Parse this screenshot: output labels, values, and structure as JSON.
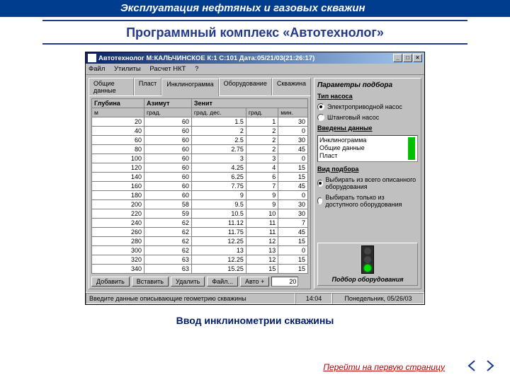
{
  "page": {
    "header": "Эксплуатация нефтяных и газовых скважин",
    "subtitle": "Программный комплекс «Автотехнолог»",
    "caption": "Ввод инклинометрии скважины",
    "first_page_link": "Перейти на первую страницу"
  },
  "app": {
    "title": "Автотехнолог М:КАЛЬЧИНСКОЕ  К:1  С:101  Дата:05/21/03(21:26:17)",
    "menu": [
      "Файл",
      "Утилиты",
      "Расчет НКТ",
      "?"
    ],
    "tabs": [
      "Общие данные",
      "Пласт",
      "Инклинограмма",
      "Оборудование",
      "Скважина"
    ],
    "active_tab": 2,
    "table": {
      "headers": [
        "Глубина",
        "Азимут",
        "Зенит",
        ""
      ],
      "subheaders": [
        "м",
        "град.",
        "град. дес.",
        "град.",
        "мин."
      ],
      "rows": [
        [
          20,
          60,
          1.5,
          1,
          30
        ],
        [
          40,
          60,
          2,
          2,
          0
        ],
        [
          60,
          60,
          2.5,
          2,
          30
        ],
        [
          80,
          60,
          2.75,
          2,
          45
        ],
        [
          100,
          60,
          3,
          3,
          0
        ],
        [
          120,
          60,
          4.25,
          4,
          15
        ],
        [
          140,
          60,
          6.25,
          6,
          15
        ],
        [
          160,
          60,
          7.75,
          7,
          45
        ],
        [
          180,
          60,
          9,
          9,
          0
        ],
        [
          200,
          58,
          9.5,
          9,
          30
        ],
        [
          220,
          59,
          10.5,
          10,
          30
        ],
        [
          240,
          62,
          11.12,
          11,
          7
        ],
        [
          260,
          62,
          11.75,
          11,
          45
        ],
        [
          280,
          62,
          12.25,
          12,
          15
        ],
        [
          300,
          62,
          13,
          13,
          0
        ],
        [
          320,
          63,
          12.25,
          12,
          15
        ],
        [
          340,
          63,
          15.25,
          15,
          15
        ]
      ]
    },
    "buttons": {
      "add": "Добавить",
      "insert": "Вставить",
      "delete": "Удалить",
      "file": "Файл...",
      "auto": "Авто +"
    },
    "step_value": "20",
    "params": {
      "title": "Параметры подбора",
      "pump_type_label": "Тип насоса",
      "pump_options": [
        "Электроприводной насос",
        "Штанговый насос"
      ],
      "pump_selected": 0,
      "data_entered_label": "Введены данные",
      "data_entered": [
        "Инклинограмма",
        "Общие данные",
        "Пласт"
      ],
      "mode_label": "Вид подбора",
      "mode_options": [
        "Выбирать из всего описанного оборудования",
        "Выбирать только из доступного оборудования"
      ],
      "mode_selected": 0,
      "action_label": "Подбор оборудования"
    },
    "status": {
      "message": "Введите данные описывающие геометрию скважины",
      "time": "14:04",
      "date": "Понедельник, 05/26/03"
    }
  }
}
